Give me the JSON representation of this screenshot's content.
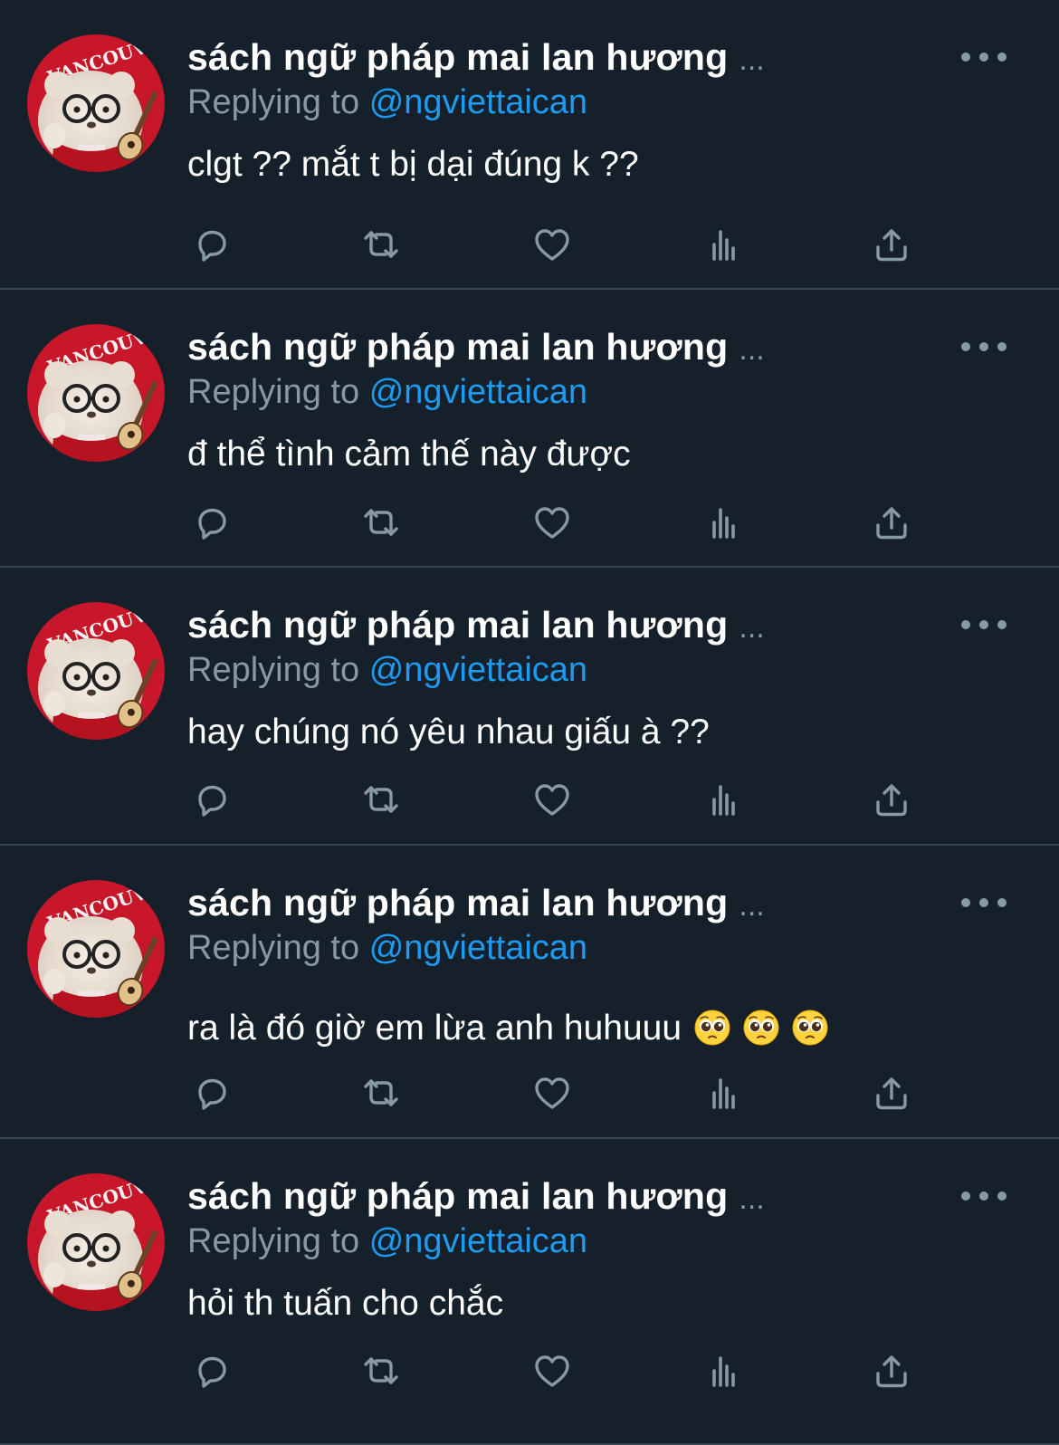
{
  "tweets": [
    {
      "name": "sách ngữ pháp mai lan hương",
      "name_ellipsis": "...",
      "replying_label": "Replying to",
      "replying_handle": "@ngviettaican",
      "text": "clgt ?? mắt t bị dại đúng k ??",
      "emoji_count": 0
    },
    {
      "name": "sách ngữ pháp mai lan hương",
      "name_ellipsis": "...",
      "replying_label": "Replying to",
      "replying_handle": "@ngviettaican",
      "text": "đ thể tình cảm thế này được",
      "emoji_count": 0
    },
    {
      "name": "sách ngữ pháp mai lan hương",
      "name_ellipsis": "...",
      "replying_label": "Replying to",
      "replying_handle": "@ngviettaican",
      "text": "hay chúng nó yêu nhau giấu à ??",
      "emoji_count": 0
    },
    {
      "name": "sách ngữ pháp mai lan hương",
      "name_ellipsis": "...",
      "replying_label": "Replying to",
      "replying_handle": "@ngviettaican",
      "text": "ra là đó giờ em lừa anh huhuuu",
      "emoji_count": 3,
      "emoji_icon": "pleading-face-emoji"
    },
    {
      "name": "sách ngữ pháp mai lan hương",
      "name_ellipsis": "...",
      "replying_label": "Replying to",
      "replying_handle": "@ngviettaican",
      "text": "hỏi th tuấn cho chắc",
      "emoji_count": 0
    }
  ],
  "actions": [
    "reply-icon",
    "retweet-icon",
    "like-icon",
    "views-icon",
    "share-icon"
  ],
  "avatar": {
    "shirt_text": "VANCOUVER"
  },
  "colors": {
    "background": "#15202b",
    "divider": "#38444d",
    "muted": "#8899a6",
    "link": "#1d9bf0",
    "text": "#ffffff",
    "avatar_red": "#c8162a"
  }
}
